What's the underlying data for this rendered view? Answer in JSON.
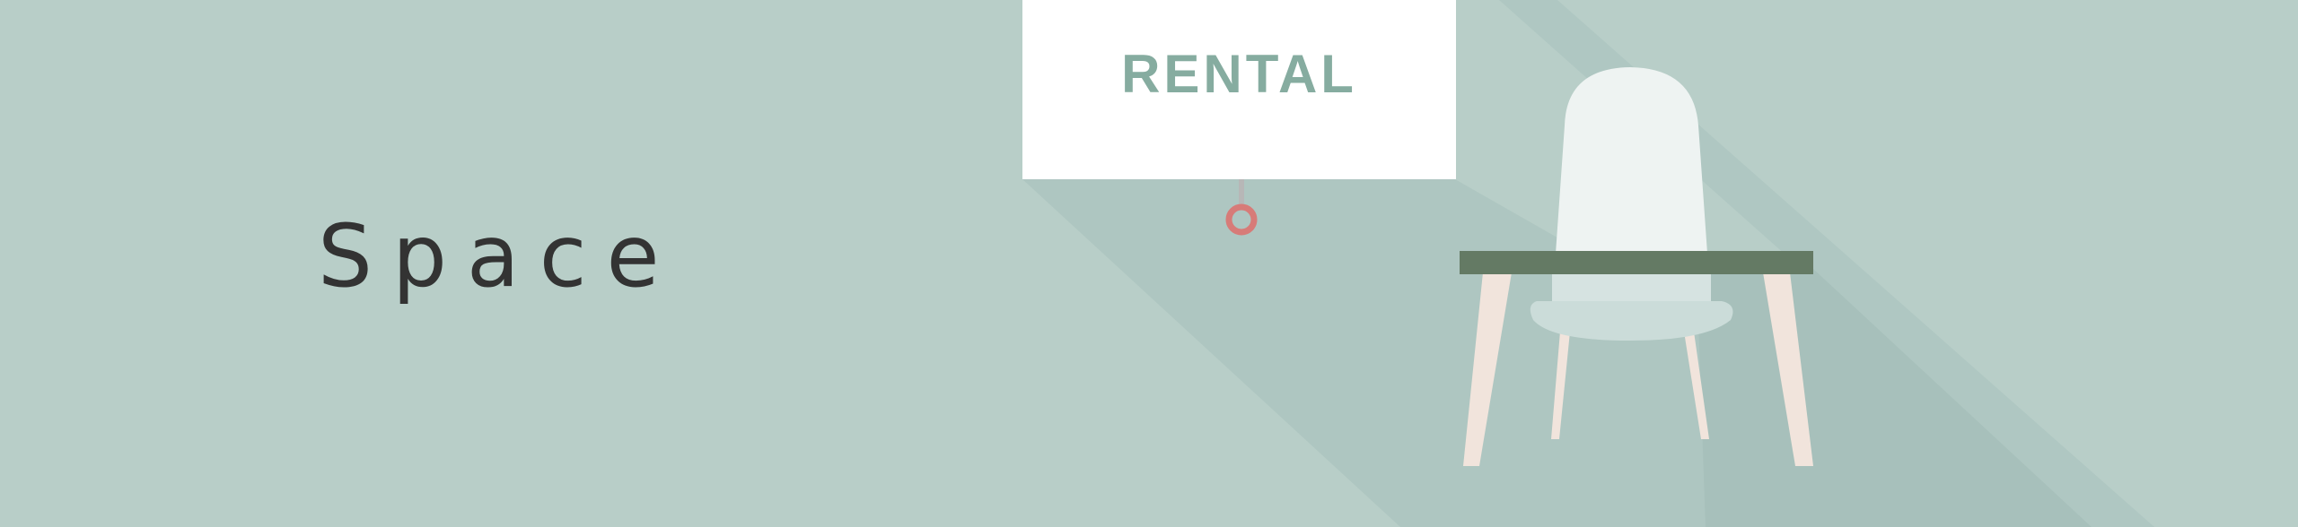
{
  "banner": {
    "heading": "Space",
    "sign_label": "RENTAL"
  },
  "colors": {
    "background": "#b8cec8",
    "shadow": "#a8c2bd",
    "sign": "#ffffff",
    "sign_text": "#86aca0",
    "ring": "#d77b78",
    "table_top": "#647a64",
    "chair_back": "#eef3f2",
    "chair_seat": "#cbdcd9",
    "legs": "#f1e4dc",
    "heading_text": "#333333"
  },
  "icons": [
    "rental-sign-icon",
    "hanging-ring-icon",
    "table-icon",
    "chair-icon"
  ]
}
